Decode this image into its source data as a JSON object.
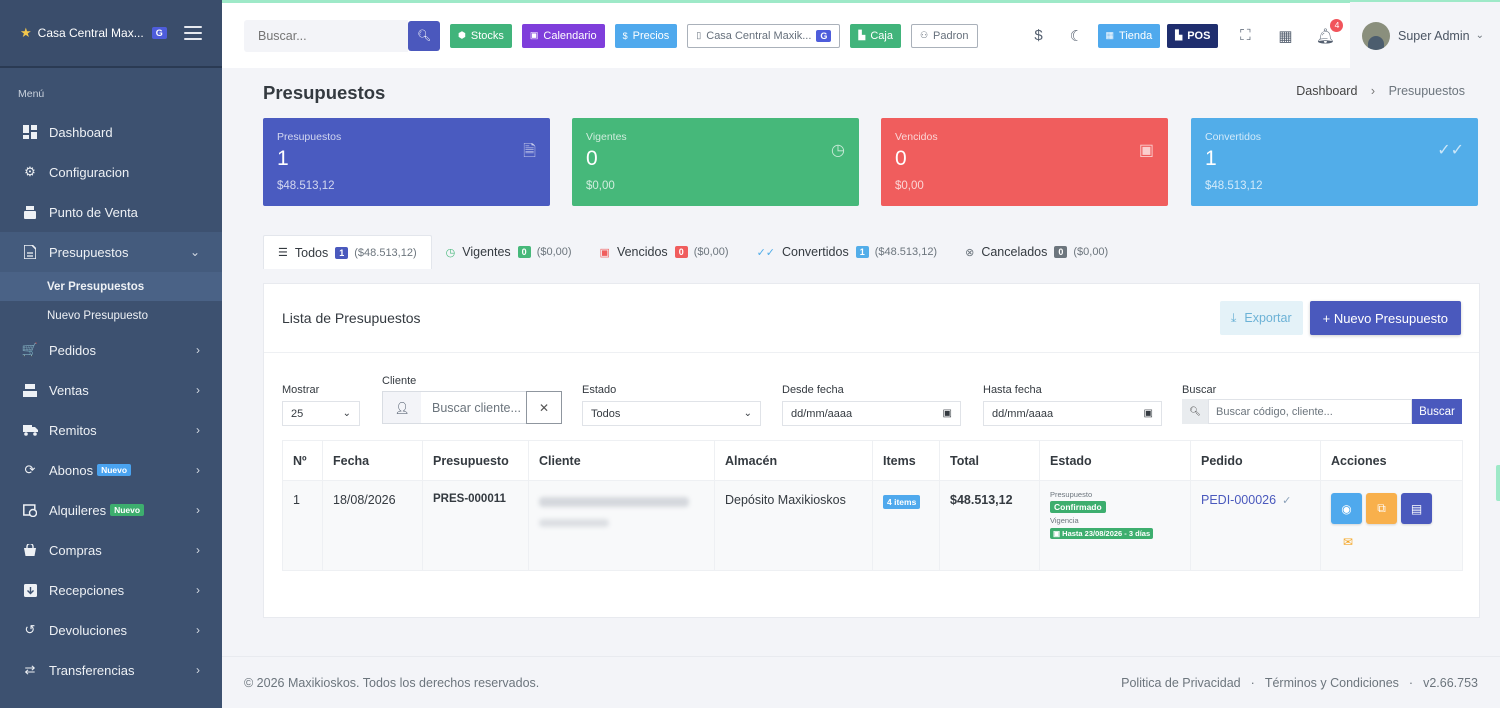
{
  "sidebar": {
    "brand": "Casa Central Max...",
    "brand_badge": "G",
    "menu_title": "Menú",
    "items": [
      {
        "label": "Dashboard"
      },
      {
        "label": "Configuracion"
      },
      {
        "label": "Punto de Venta"
      },
      {
        "label": "Presupuestos"
      },
      {
        "label": "Pedidos"
      },
      {
        "label": "Ventas"
      },
      {
        "label": "Remitos"
      },
      {
        "label": "Abonos",
        "badge": "Nuevo"
      },
      {
        "label": "Alquileres",
        "badge": "Nuevo"
      },
      {
        "label": "Compras"
      },
      {
        "label": "Recepciones"
      },
      {
        "label": "Devoluciones"
      },
      {
        "label": "Transferencias"
      }
    ],
    "subitems": [
      "Ver Presupuestos",
      "Nuevo Presupuesto"
    ]
  },
  "topbar": {
    "search_placeholder": "Buscar...",
    "buttons": {
      "stocks": "Stocks",
      "calendario": "Calendario",
      "precios": "Precios",
      "casa": "Casa Central Maxik...",
      "casa_badge": "G",
      "caja": "Caja",
      "padron": "Padron",
      "tienda": "Tienda",
      "pos": "POS"
    },
    "currency_icon": "$",
    "notif_count": "4",
    "user": "Super Admin"
  },
  "page": {
    "title": "Presupuestos",
    "breadcrumb": [
      "Dashboard",
      "Presupuestos"
    ]
  },
  "cards": [
    {
      "label": "Presupuestos",
      "value": "1",
      "amount": "$48.513,12",
      "color": "#4a5bc0"
    },
    {
      "label": "Vigentes",
      "value": "0",
      "amount": "$0,00",
      "color": "#46b87a"
    },
    {
      "label": "Vencidos",
      "value": "0",
      "amount": "$0,00",
      "color": "#f05d5d"
    },
    {
      "label": "Convertidos",
      "value": "1",
      "amount": "$48.513,12",
      "color": "#52ade9"
    }
  ],
  "tabs": [
    {
      "label": "Todos",
      "count": "1",
      "amount": "($48.513,12)"
    },
    {
      "label": "Vigentes",
      "count": "0",
      "amount": "($0,00)"
    },
    {
      "label": "Vencidos",
      "count": "0",
      "amount": "($0,00)"
    },
    {
      "label": "Convertidos",
      "count": "1",
      "amount": "($48.513,12)"
    },
    {
      "label": "Cancelados",
      "count": "0",
      "amount": "($0,00)"
    }
  ],
  "panel": {
    "title": "Lista de Presupuestos",
    "export_label": "Exportar",
    "new_label": "+ Nuevo Presupuesto"
  },
  "filters": {
    "mostrar_label": "Mostrar",
    "mostrar_value": "25",
    "cliente_label": "Cliente",
    "cliente_placeholder": "Buscar cliente...",
    "estado_label": "Estado",
    "estado_value": "Todos",
    "desde_label": "Desde fecha",
    "desde_value": "dd/mm/aaaa",
    "hasta_label": "Hasta fecha",
    "hasta_value": "dd/mm/aaaa",
    "buscar_label": "Buscar",
    "buscar_placeholder": "Buscar código, cliente...",
    "buscar_button": "Buscar"
  },
  "table": {
    "headers": [
      "Nº",
      "Fecha",
      "Presupuesto",
      "Cliente",
      "Almacén",
      "Items",
      "Total",
      "Estado",
      "Pedido",
      "Acciones"
    ],
    "rows": [
      {
        "n": "1",
        "fecha": "18/08/2026",
        "presupuesto": "PRES-000011",
        "almacen": "Depósito Maxikioskos",
        "items": "4 items",
        "total": "$48.513,12",
        "estado_label": "Presupuesto",
        "estado": "Confirmado",
        "vigencia_label": "Vigencia",
        "vigencia": "Hasta 23/08/2026 - 3 días",
        "pedido": "PEDI-000026"
      }
    ]
  },
  "footer": {
    "copyright": "© 2026 Maxikioskos. Todos los derechos reservados.",
    "privacy": "Politica de Privacidad",
    "terms": "Términos y Condiciones",
    "version": "v2.66.753"
  }
}
